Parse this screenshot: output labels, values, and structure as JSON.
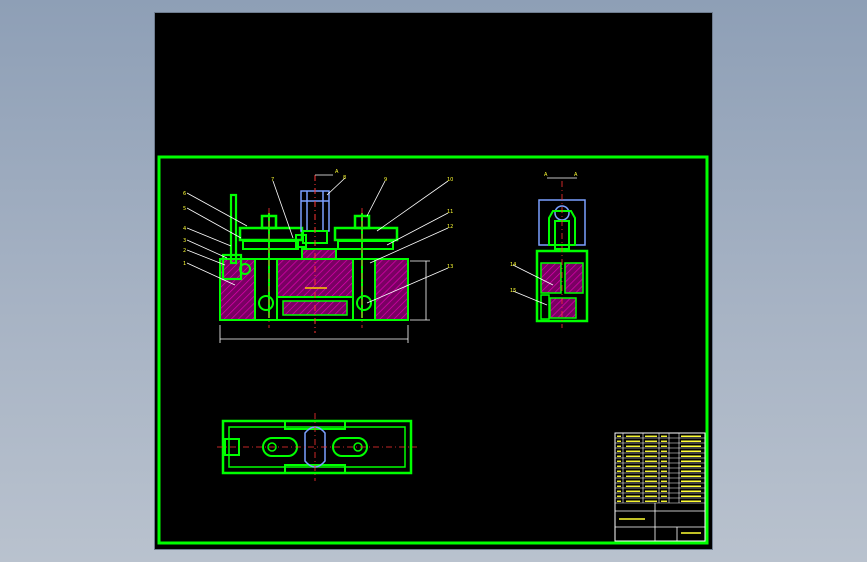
{
  "drawing": {
    "frame_color": "#00ff00",
    "line_color": "#00ff00",
    "text_color": "#ffff00",
    "hatch_color": "#c0008c",
    "centerline_color": "#ff3333",
    "dimension_color": "#ffffff",
    "background": "#000000",
    "workspace_background": "#9aa9bd"
  },
  "callouts_front": [
    "6",
    "5",
    "4",
    "3",
    "2",
    "1",
    "7",
    "8",
    "9",
    "10",
    "11",
    "12",
    "13"
  ],
  "callouts_side": [
    "14",
    "15"
  ],
  "section_marks": {
    "front": [
      "A",
      "A"
    ],
    "side": [
      "A",
      "A"
    ]
  },
  "title_block": {
    "rows": 14
  }
}
